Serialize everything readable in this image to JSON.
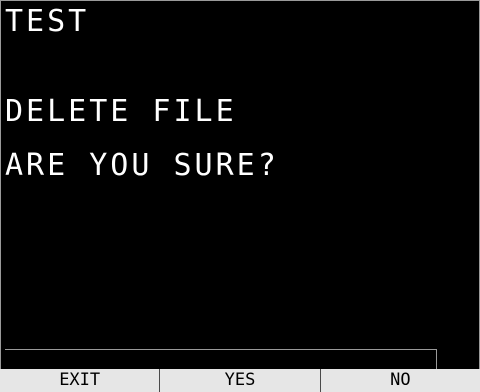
{
  "screen": {
    "title": "TEST",
    "message_line1": "DELETE FILE",
    "message_line2": "ARE YOU SURE?"
  },
  "softkeys": [
    {
      "label": "EXIT"
    },
    {
      "label": "YES"
    },
    {
      "label": "NO"
    }
  ],
  "colors": {
    "background": "#000000",
    "text": "#ffffff",
    "softkey_background": "#e6e6e6",
    "softkey_text": "#000000",
    "border": "#9a9a9a"
  }
}
